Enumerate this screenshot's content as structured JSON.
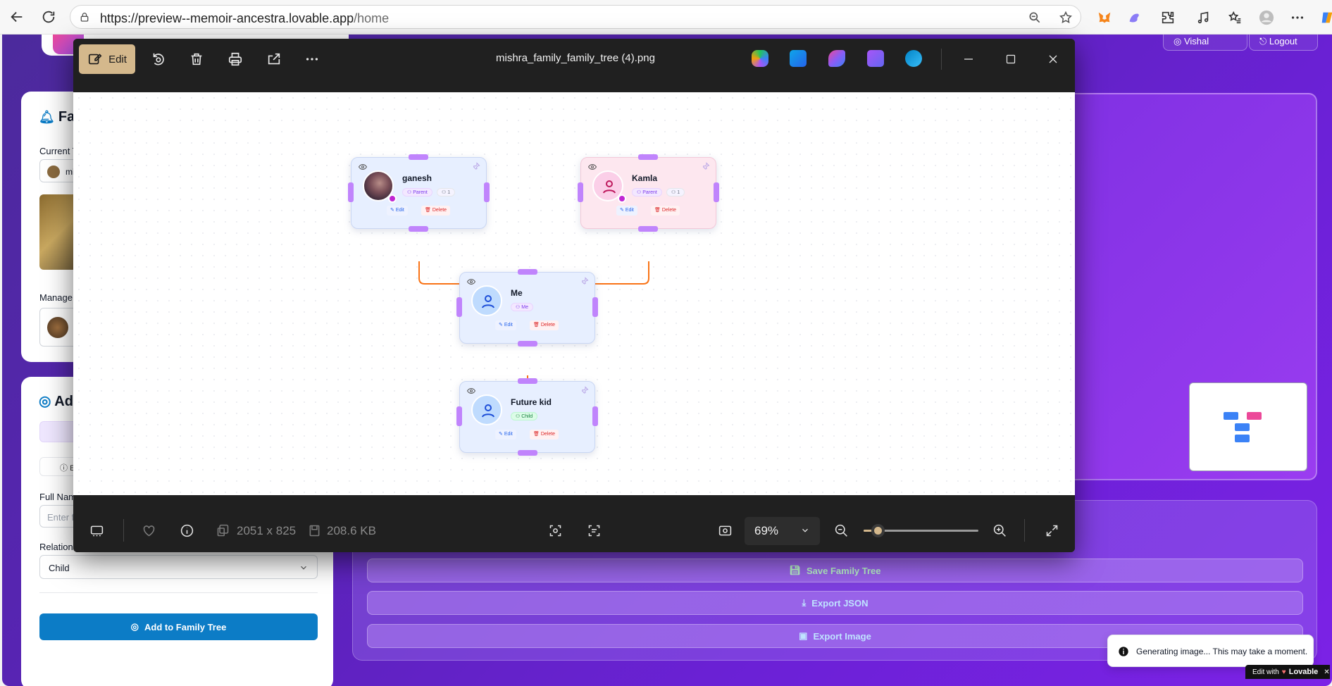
{
  "browser": {
    "url_main": "https://preview--memoir-ancestra.lovable.app",
    "url_path": "/home"
  },
  "app": {
    "user_label": "Vishal",
    "logout_label": "Logout",
    "left_panel_title": "Far",
    "current_tree_label": "Current Tr",
    "current_tree_value": "mi",
    "manage_label": "Manage T",
    "add_title": "Ad",
    "tab_label": "E",
    "full_name_label": "Full Name",
    "full_name_placeholder": "Enter fu",
    "relationship_label": "Relationship",
    "relationship_value": "Child",
    "add_button": "Add to Family Tree",
    "save_button": "Save Family Tree",
    "export_json_button": "Export JSON",
    "export_image_button": "Export Image",
    "toast_text": "Generating image... This may take a moment.",
    "edit_with": "Edit with",
    "lovable": "Lovable"
  },
  "viewer": {
    "edit_label": "Edit",
    "file_name": "mishra_family_family_tree (4).png",
    "dimensions": "2051 x 825",
    "file_size": "208.6 KB",
    "zoom": "69%",
    "zoom_fraction": 0.13
  },
  "tree": {
    "nodes": [
      {
        "name": "ganesh",
        "tag": "Parent",
        "count": "1",
        "edit": "Edit",
        "delete": "Delete"
      },
      {
        "name": "Kamla",
        "tag": "Parent",
        "count": "1",
        "edit": "Edit",
        "delete": "Delete"
      },
      {
        "name": "Me",
        "tag": "Me",
        "edit": "Edit",
        "delete": "Delete"
      },
      {
        "name": "Future kid",
        "tag": "Child",
        "edit": "Edit",
        "delete": "Delete"
      }
    ]
  },
  "colors": {
    "accent_gold": "#d4b88c",
    "primary_blue": "#0c7cc6",
    "handle_purple": "#c084fc",
    "edge_orange": "#f97316",
    "delete_red": "#ef4444"
  }
}
